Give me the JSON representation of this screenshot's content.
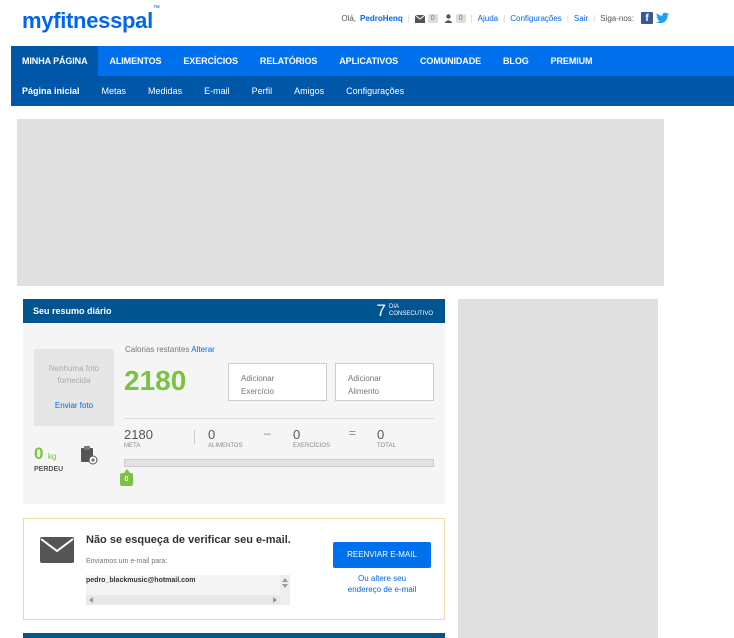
{
  "brand": {
    "logo": "myfitnesspal",
    "tm": "™",
    "color": "#0066ee"
  },
  "header": {
    "greeting": "Olá,",
    "username": "PedroHenq",
    "messages_count": "0",
    "friends_count": "0",
    "help": "Ajuda",
    "settings": "Configurações",
    "logout": "Sair",
    "follow": "Siga-nos:"
  },
  "main_nav": [
    {
      "label": "MINHA PÁGINA",
      "active": true
    },
    {
      "label": "ALIMENTOS"
    },
    {
      "label": "EXERCÍCIOS"
    },
    {
      "label": "RELATÓRIOS"
    },
    {
      "label": "APLICATIVOS"
    },
    {
      "label": "COMUNIDADE"
    },
    {
      "label": "BLOG"
    },
    {
      "label": "PREMIUM"
    }
  ],
  "sub_nav": [
    {
      "label": "Página inicial",
      "active": true
    },
    {
      "label": "Metas"
    },
    {
      "label": "Medidas"
    },
    {
      "label": "E-mail"
    },
    {
      "label": "Perfil"
    },
    {
      "label": "Amigos"
    },
    {
      "label": "Configurações"
    }
  ],
  "summary": {
    "title": "Seu resumo diário",
    "streak_days": "7",
    "streak_label_1": "DIA",
    "streak_label_2": "CONSECUTIVO",
    "photo_missing_1": "Nenhuma foto",
    "photo_missing_2": "fornecida",
    "send_photo": "Enviar foto",
    "weight_lost_value": "0",
    "weight_unit": "kg",
    "weight_lost_label": "PERDEU",
    "calories_remaining_label": "Calorias restantes",
    "change_link": "Alterar",
    "calories_remaining": "2180",
    "add_exercise_1": "Adicionar",
    "add_exercise_2": "Exercício",
    "add_food_1": "Adicionar",
    "add_food_2": "Alimento",
    "goal_value": "2180",
    "goal_label": "META",
    "food_value": "0",
    "food_label": "ALIMENTOS",
    "exercise_value": "0",
    "exercise_label": "EXERCÍCIOS",
    "total_value": "0",
    "total_label": "TOTAL",
    "minus": "–",
    "equals": "=",
    "progress_fraction": 0,
    "progress_marker": "0"
  },
  "email_card": {
    "title": "Não se esqueça de verificar seu e-mail.",
    "sent_to": "Enviamos um e-mail para:",
    "address": "pedro_blackmusic@hotmail.com",
    "resend": "REENVIAR E-MAIL",
    "alter_1": "Ou altere seu",
    "alter_2": "endereço de e-mail"
  }
}
